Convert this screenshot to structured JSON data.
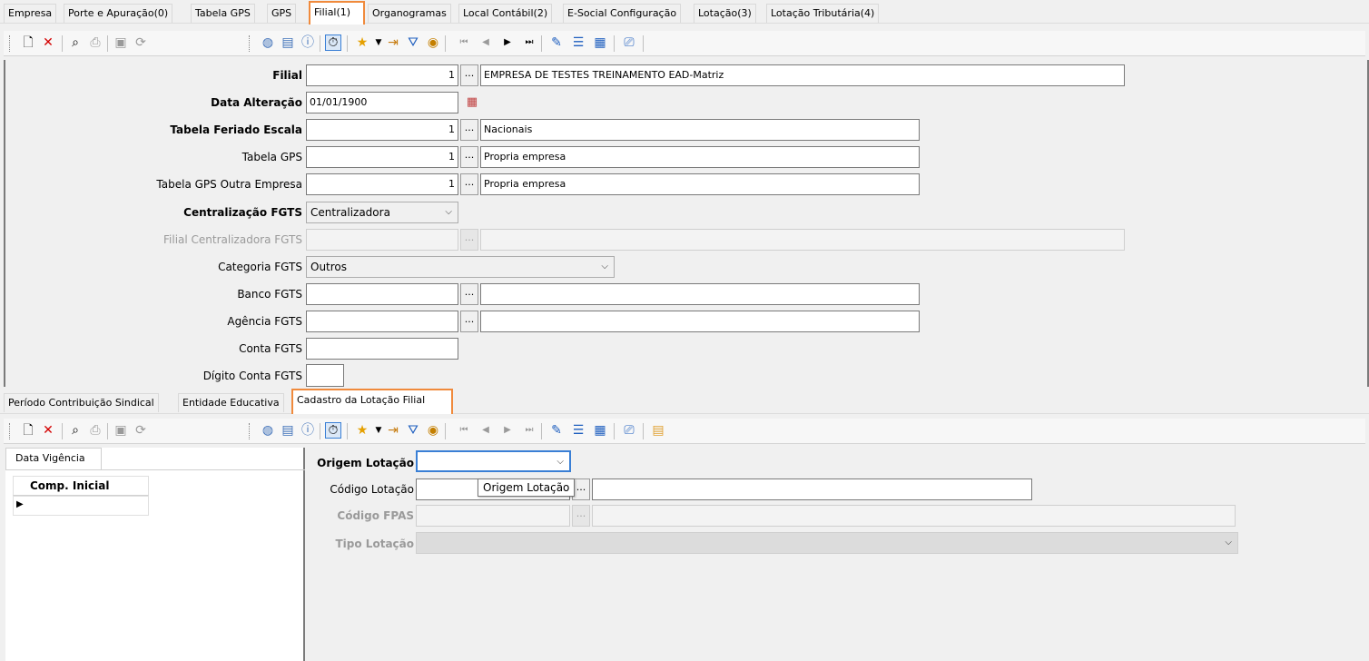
{
  "top_tabs": [
    "Empresa",
    "Porte e Apuração(0)",
    "Tabela GPS",
    "GPS",
    "Filial(1)",
    "Organogramas",
    "Local Contábil(2)",
    "E-Social Configuração",
    "Lotação(3)",
    "Lotação Tributária(4)"
  ],
  "form": {
    "filial": {
      "label": "Filial",
      "code": "1",
      "button": "...",
      "desc": "EMPRESA DE TESTES TREINAMENTO EAD-Matriz"
    },
    "data_alteracao": {
      "label": "Data Alteração",
      "value": "01/01/1900"
    },
    "tabela_feriado": {
      "label": "Tabela Feriado Escala",
      "code": "1",
      "button": "...",
      "desc": "Nacionais"
    },
    "tabela_gps": {
      "label": "Tabela GPS",
      "code": "1",
      "button": "...",
      "desc": "Propria empresa"
    },
    "tabela_gps_outra": {
      "label": "Tabela GPS Outra Empresa",
      "code": "1",
      "button": "...",
      "desc": "Propria empresa"
    },
    "centralizacao": {
      "label": "Centralização FGTS",
      "value": "Centralizadora"
    },
    "filial_centralizadora": {
      "label": "Filial Centralizadora FGTS",
      "button": "..."
    },
    "categoria": {
      "label": "Categoria FGTS",
      "value": "Outros"
    },
    "banco": {
      "label": "Banco FGTS",
      "button": "..."
    },
    "agencia": {
      "label": "Agência FGTS",
      "button": "..."
    },
    "conta": {
      "label": "Conta FGTS"
    },
    "digito": {
      "label": "Dígito Conta FGTS"
    }
  },
  "bottom_tabs": [
    "Período Contribuição Sindical",
    "Entidade Educativa",
    "Cadastro da Lotação Filial"
  ],
  "left_panel": {
    "tab": "Data Vigência",
    "column": "Comp. Inicial"
  },
  "lotacao": {
    "origem": {
      "label": "Origem Lotação",
      "value": ""
    },
    "codigo": {
      "label": "Código Lotação",
      "button": "..."
    },
    "fpas": {
      "label": "Código FPAS",
      "button": "..."
    },
    "tipo": {
      "label": "Tipo Lotação"
    },
    "tooltip": "Origem Lotação"
  },
  "colors": {
    "accent": "#f08a3c",
    "focus": "#3a7fd5"
  }
}
